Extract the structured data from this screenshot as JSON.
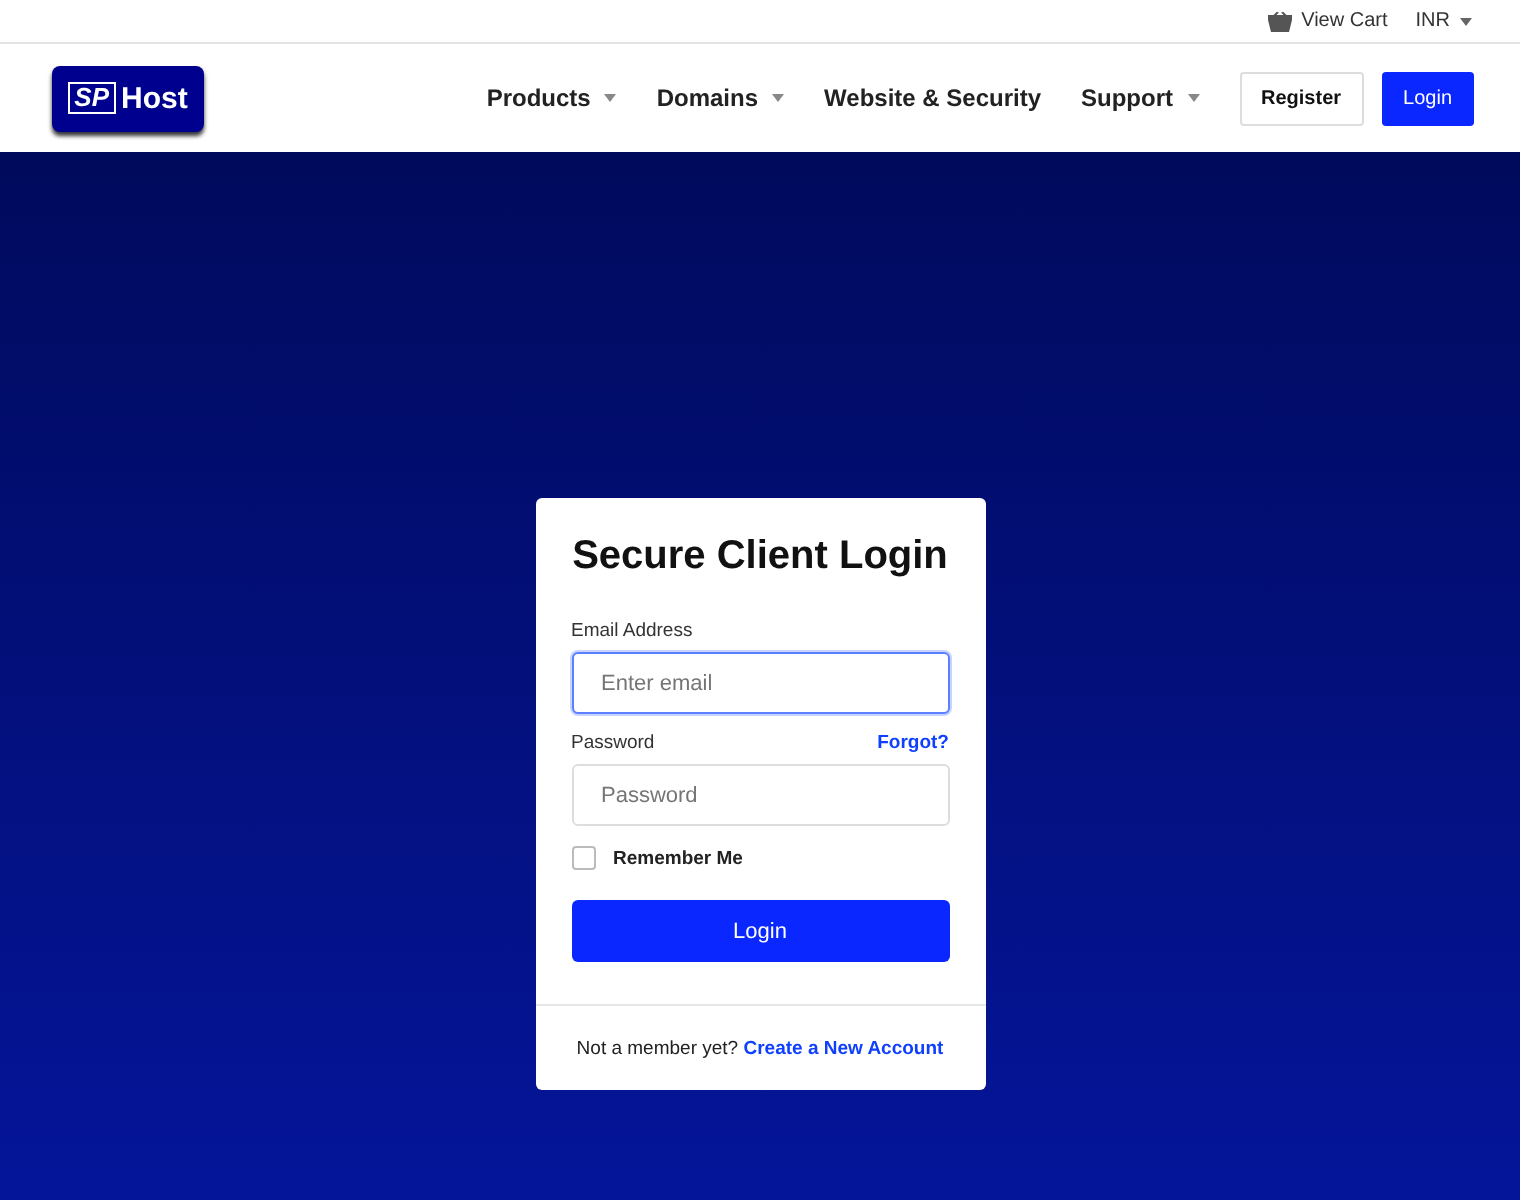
{
  "topbar": {
    "cart": "View Cart",
    "currency": "INR"
  },
  "logo": {
    "mark": "SP",
    "name": "Host"
  },
  "nav": [
    {
      "label": "Products",
      "dropdown": true
    },
    {
      "label": "Domains",
      "dropdown": true
    },
    {
      "label": "Website & Security",
      "dropdown": false
    },
    {
      "label": "Support",
      "dropdown": true
    }
  ],
  "header_buttons": [
    {
      "label": "Register",
      "kind": "outline"
    },
    {
      "label": "Login",
      "kind": "primary"
    }
  ],
  "login": {
    "title": "Secure Client Login",
    "email_label": "Email Address",
    "email_placeholder": "Enter email",
    "email_focused": true,
    "password_label": "Password",
    "forgot": "Forgot?",
    "password_placeholder": "Password",
    "remember": {
      "label": "Remember Me",
      "checked": false
    },
    "submit": "Login",
    "footer_text": "Not a member yet?",
    "footer_link": "Create a New Account"
  }
}
